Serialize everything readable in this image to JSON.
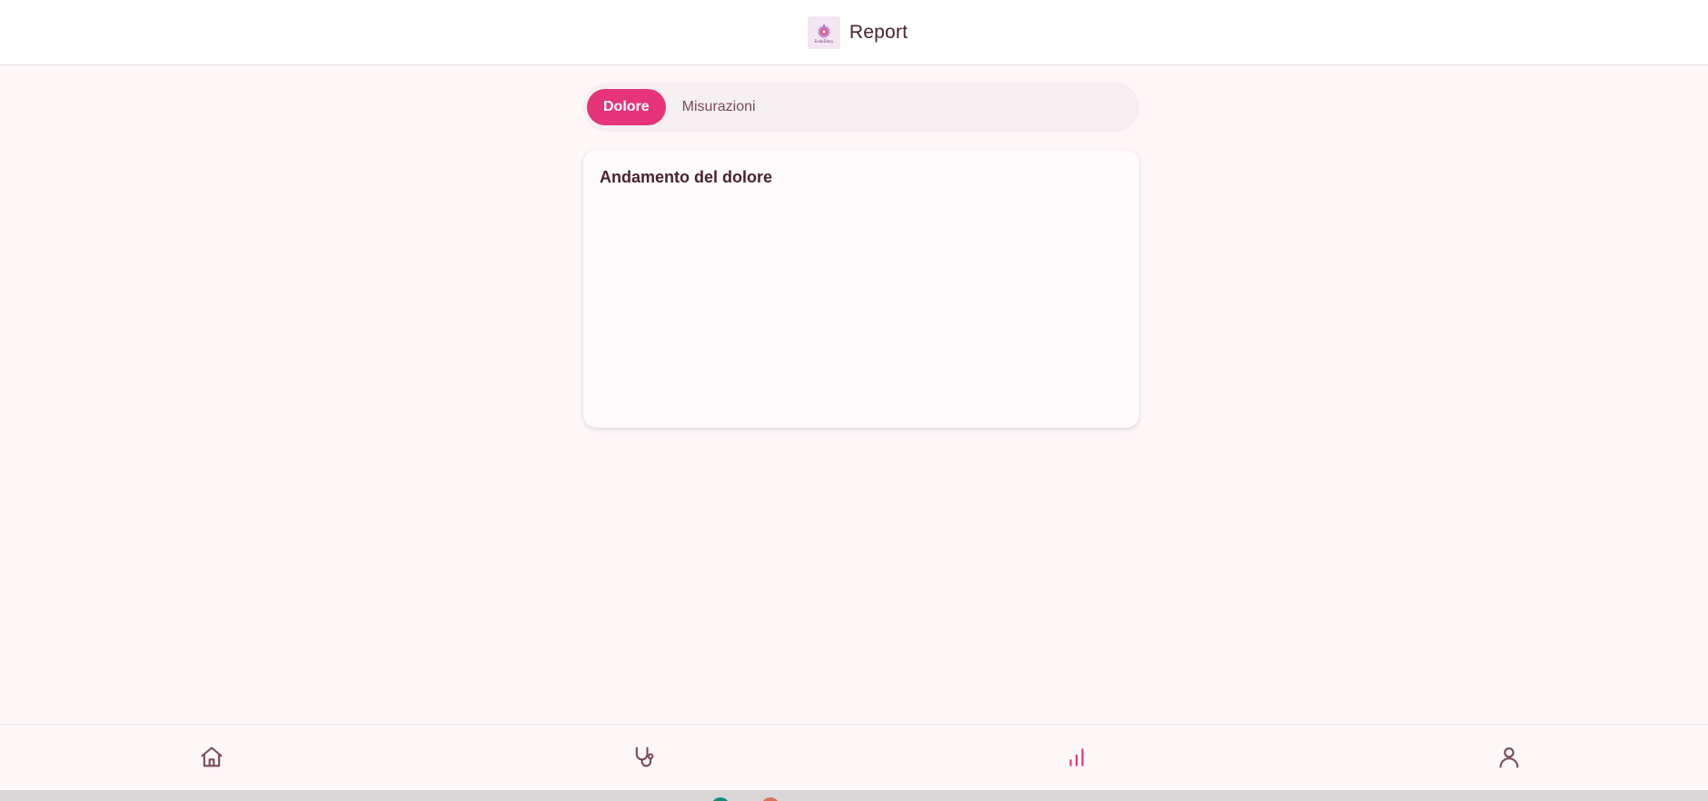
{
  "header": {
    "logo_text": "EndoDiary",
    "title": "Report"
  },
  "tabs": [
    {
      "label": "Dolore",
      "active": true
    },
    {
      "label": "Misurazioni",
      "active": false
    }
  ],
  "card": {
    "title": "Andamento del dolore"
  },
  "bottom_nav": [
    {
      "icon": "home-icon",
      "active": false
    },
    {
      "icon": "stethoscope-icon",
      "active": false
    },
    {
      "icon": "bar-chart-icon",
      "active": true
    },
    {
      "icon": "user-icon",
      "active": false
    }
  ],
  "colors": {
    "accent": "#e6337a",
    "nav_inactive": "#7b4a5c",
    "background": "#fdf7f8"
  }
}
